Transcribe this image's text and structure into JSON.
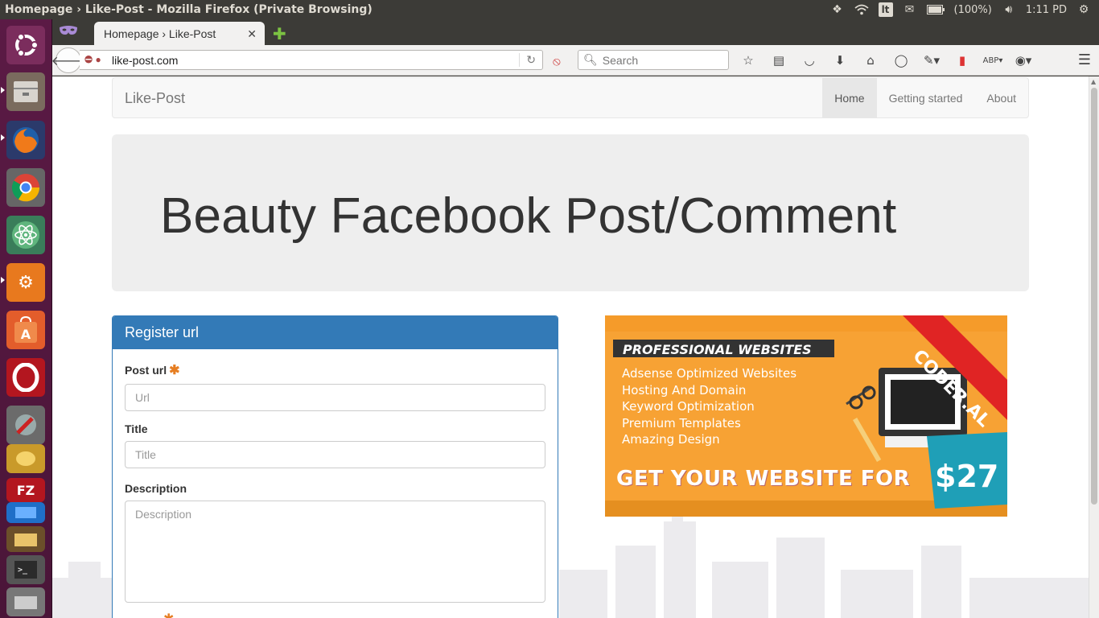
{
  "os": {
    "window_title": "Homepage › Like-Post - Mozilla Firefox (Private Browsing)",
    "tray": {
      "language": "lt",
      "battery": "(100%)",
      "clock": "1:11 PD"
    }
  },
  "browser": {
    "tab_title": "Homepage › Like-Post",
    "url": "like-post.com",
    "search_placeholder": "Search"
  },
  "site": {
    "brand": "Like-Post",
    "nav": [
      "Home",
      "Getting started",
      "About"
    ],
    "active_nav": "Home",
    "hero_title": "Beauty Facebook Post/Comment"
  },
  "form": {
    "heading": "Register url",
    "fields": [
      {
        "label": "Post url",
        "placeholder": "Url",
        "required": true
      },
      {
        "label": "Title",
        "placeholder": "Title",
        "required": false
      },
      {
        "label": "Description",
        "placeholder": "Description",
        "required": false
      }
    ]
  },
  "ad": {
    "headline": "PROFESSIONAL WEBSITES",
    "features": [
      "Adsense Optimized Websites",
      "Hosting And Domain",
      "Keyword Optimization",
      "Premium Templates",
      "Amazing Design"
    ],
    "cta": "GET YOUR WEBSITE FOR",
    "price": "$27",
    "ribbon": "CODER.AL",
    "colors": {
      "background": "#f7a234",
      "price_bg": "#1f9fb7",
      "ribbon": "#e02424"
    }
  },
  "colors": {
    "panel_primary": "#337ab7",
    "launcher": "#5b1a45"
  }
}
